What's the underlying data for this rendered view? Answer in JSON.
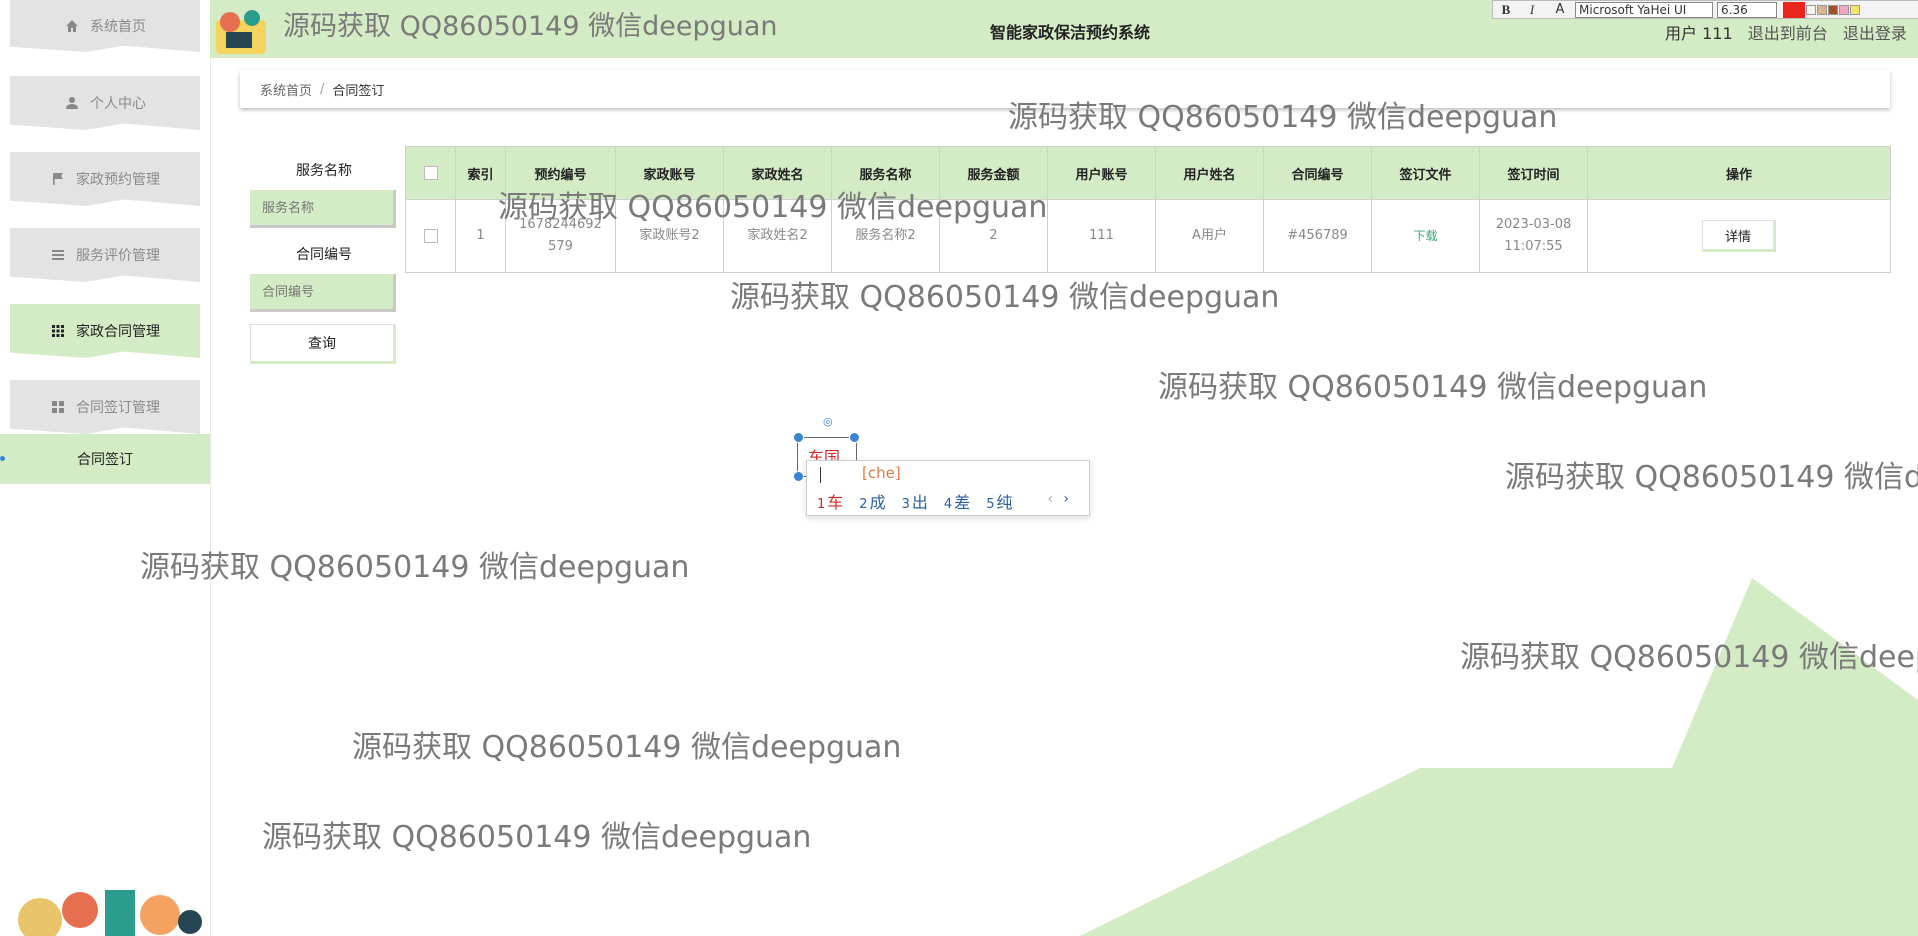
{
  "header": {
    "title": "智能家政保洁预约系统",
    "user_label": "用户 111",
    "back_front": "退出到前台",
    "logout": "退出登录"
  },
  "sidebar": {
    "items": [
      {
        "label": "系统首页",
        "icon": "home-icon"
      },
      {
        "label": "个人中心",
        "icon": "user-icon"
      },
      {
        "label": "家政预约管理",
        "icon": "flag-icon"
      },
      {
        "label": "服务评价管理",
        "icon": "list-icon"
      },
      {
        "label": "家政合同管理",
        "icon": "grid-icon"
      },
      {
        "label": "合同签订管理",
        "icon": "apps-icon"
      }
    ],
    "sub_item": "合同签订"
  },
  "toolbar": {
    "bold": "B",
    "italic": "I",
    "font_style": "A",
    "font": "Microsoft YaHei UI",
    "size": "6.36",
    "color": "#e8261c"
  },
  "breadcrumb": {
    "home": "系统首页",
    "sep": "/",
    "current": "合同签订"
  },
  "search": {
    "service_name_label": "服务名称",
    "service_name_placeholder": "服务名称",
    "contract_no_label": "合同编号",
    "contract_no_placeholder": "合同编号",
    "query": "查询"
  },
  "table": {
    "headers": [
      "索引",
      "预约编号",
      "家政账号",
      "家政姓名",
      "服务名称",
      "服务金额",
      "用户账号",
      "用户姓名",
      "合同编号",
      "签订文件",
      "签订时间",
      "操作"
    ],
    "rows": [
      {
        "index": "1",
        "booking_no_line1": "1678244692",
        "booking_no_line2": "579",
        "account": "家政账号2",
        "name": "家政姓名2",
        "service": "服务名称2",
        "amount": "2",
        "user_account": "111",
        "user_name": "A用户",
        "contract_no": "#456789",
        "file": "下载",
        "time_line1": "2023-03-08",
        "time_line2": "11:07:55",
        "action": "详情"
      }
    ]
  },
  "watermark": "源码获取 QQ86050149 微信deepguan",
  "ime": {
    "typed": "车国",
    "pinyin": "[che]",
    "candidates": [
      {
        "n": "1",
        "c": "车"
      },
      {
        "n": "2",
        "c": "成"
      },
      {
        "n": "3",
        "c": "出"
      },
      {
        "n": "4",
        "c": "差"
      },
      {
        "n": "5",
        "c": "纯"
      }
    ],
    "prev": "‹",
    "next": "›"
  },
  "colors": {
    "accent": "#d4ecc5",
    "sidebar_inactive": "#e3e3e3",
    "watermark": "#7a7a7a"
  }
}
